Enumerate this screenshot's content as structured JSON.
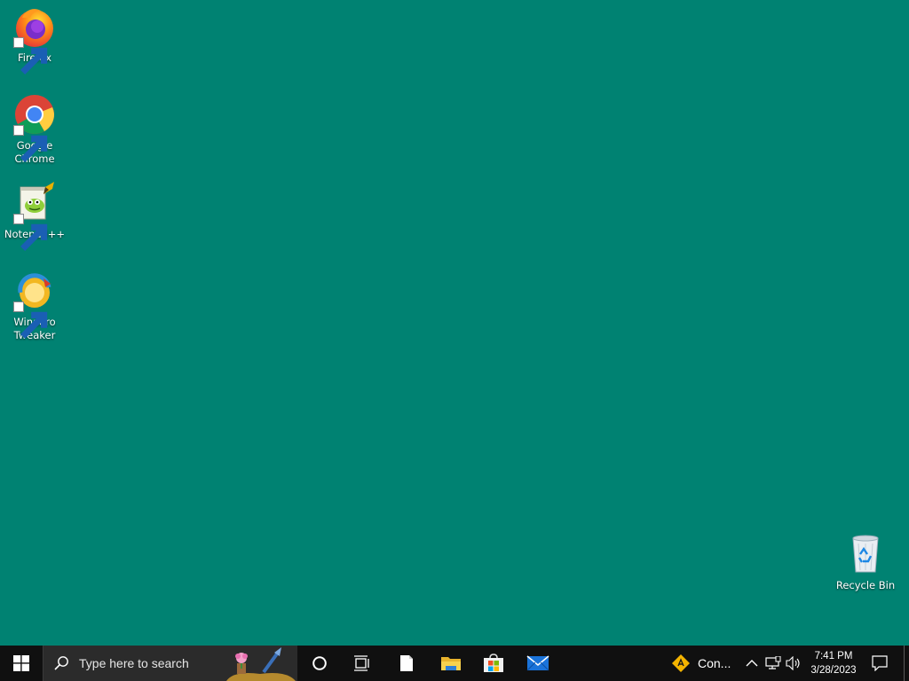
{
  "desktop": {
    "icons": [
      {
        "label": "Firefox",
        "icon": "firefox-icon"
      },
      {
        "label": "Google Chrome",
        "icon": "chrome-icon"
      },
      {
        "label": "Notepad++",
        "icon": "notepadpp-icon"
      },
      {
        "label": "Winaero Tweaker",
        "icon": "winaero-tweaker-icon"
      },
      {
        "label": "Recycle Bin",
        "icon": "recycle-bin-icon"
      }
    ],
    "background_color": "#008272"
  },
  "taskbar": {
    "search_placeholder": "Type here to search",
    "pinned": [
      "cortana-icon",
      "task-view-icon",
      "notepad-icon",
      "file-explorer-icon",
      "microsoft-store-icon",
      "mail-icon"
    ],
    "tray_app_label": "Con...",
    "clock": {
      "time": "7:41 PM",
      "date": "3/28/2023"
    }
  }
}
